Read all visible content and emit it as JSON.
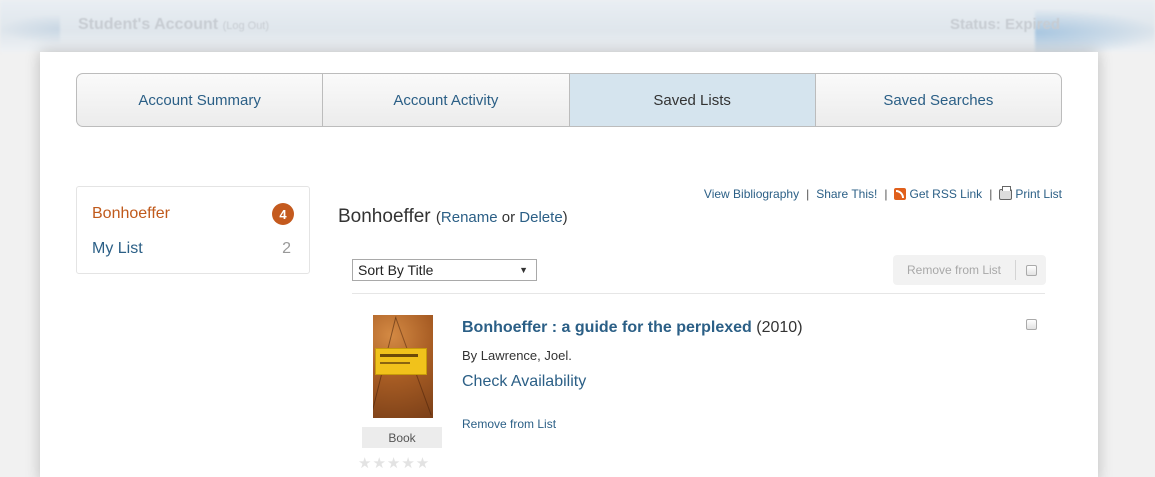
{
  "header": {
    "account_title": "Student's Account",
    "logout_label": "(Log Out)",
    "status": "Status: Expired"
  },
  "tabs": [
    {
      "label": "Account Summary",
      "active": false
    },
    {
      "label": "Account Activity",
      "active": false
    },
    {
      "label": "Saved Lists",
      "active": true
    },
    {
      "label": "Saved Searches",
      "active": false
    }
  ],
  "saved_lists": [
    {
      "name": "Bonhoeffer",
      "count": "4",
      "selected": true
    },
    {
      "name": "My List",
      "count": "2",
      "selected": false
    }
  ],
  "current_list": {
    "title": "Bonhoeffer",
    "paren_open": "(",
    "rename_label": "Rename",
    "or_label": "or",
    "delete_label": "Delete",
    "paren_close": ")"
  },
  "actions": {
    "view_bibliography": "View Bibliography",
    "share": "Share This!",
    "rss": "Get RSS Link",
    "print": "Print List",
    "separator": "|"
  },
  "sort": {
    "selected": "Sort By Title"
  },
  "remove_from_list_button": "Remove from List",
  "items": [
    {
      "title": "Bonhoeffer : a guide for the perplexed",
      "year": "(2010)",
      "author": "By Lawrence, Joel.",
      "availability_link": "Check Availability",
      "remove_link": "Remove from List",
      "format": "Book",
      "rating": "★★★★★",
      "rating_value": 0
    }
  ],
  "colors": {
    "link": "#2b5f86",
    "active_list": "#c05a1c",
    "badge": "#c45a1e",
    "active_tab": "#d5e4ee"
  },
  "icons": [
    "rss-icon",
    "print-icon",
    "dropdown-arrow-icon",
    "checkbox"
  ]
}
